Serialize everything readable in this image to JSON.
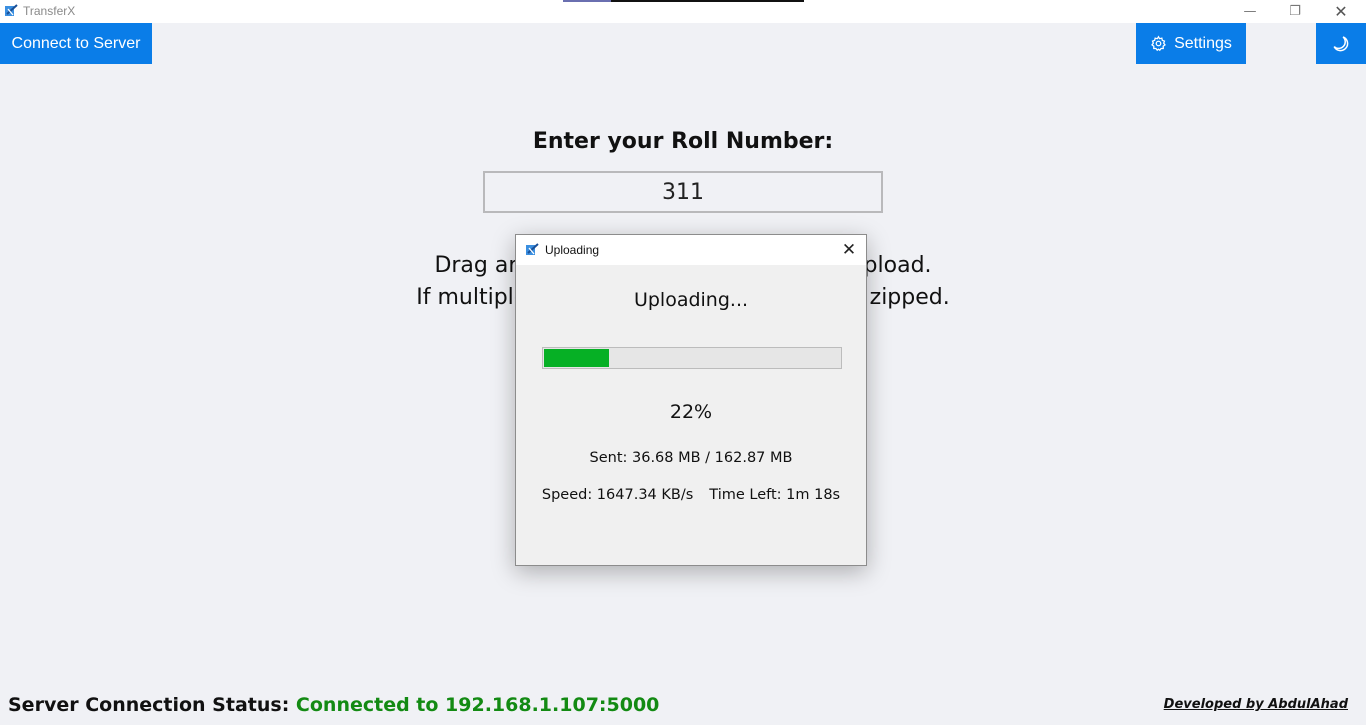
{
  "window": {
    "title": "TransferX",
    "controls": {
      "minimize": "—",
      "maximize": "❐",
      "close": "✕"
    }
  },
  "toolbar": {
    "connect_label": "Connect to Server",
    "settings_label": "Settings",
    "settings_icon": "gear-icon",
    "theme_icon": "moon-icon",
    "accent_color": "#0a7de8"
  },
  "main": {
    "roll_title": "Enter your Roll Number:",
    "roll_value": "311",
    "drop_line1": "Drag and drop files or folders here to upload.",
    "drop_line2": "If multiple files are selected, they will be zipped."
  },
  "dialog": {
    "title": "Uploading",
    "heading": "Uploading...",
    "progress_fraction": 0.22,
    "progress_color": "#06b025",
    "percent_text": "22%",
    "sent_text": "Sent: 36.68 MB / 162.87 MB",
    "speed_text": "Speed: 1647.34 KB/s",
    "time_left_text": "Time Left: 1m 18s",
    "close_glyph": "✕"
  },
  "status": {
    "label": "Server Connection Status:",
    "value": "Connected to 192.168.1.107:5000",
    "value_color": "#138a13"
  },
  "footer": {
    "credit": "Developed by AbdulAhad"
  }
}
